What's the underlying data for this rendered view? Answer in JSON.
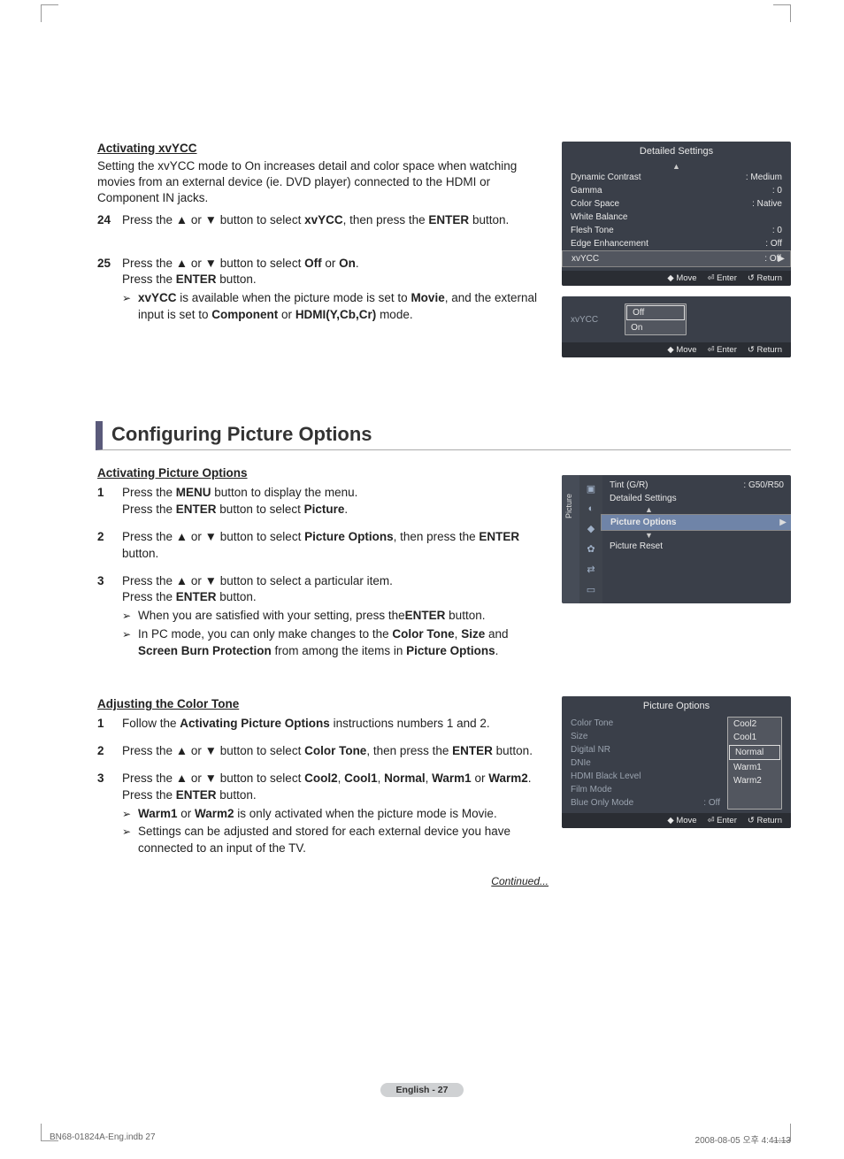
{
  "sec1": {
    "heading": "Activating xvYCC",
    "intro": "Setting the xvYCC mode to On increases detail and color space when watching movies from an external device (ie. DVD player) connected to the HDMI or Component IN jacks.",
    "steps": [
      {
        "num": "24",
        "t1": "Press the ▲ or ▼ button to select ",
        "b1": "xvYCC",
        "t2": ", then press the ",
        "b2": "ENTER",
        "t3": " button."
      },
      {
        "num": "25",
        "l1a": "Press the ▲ or ▼ button to select ",
        "l1b": "Off",
        "l1c": " or ",
        "l1d": "On",
        "l1e": ".",
        "l2a": "Press the ",
        "l2b": "ENTER",
        "l2c": " button.",
        "n1b": "xvYCC",
        "n1a": " is available when the picture mode is set to ",
        "n1c": "Movie",
        "n1d": ", and the external input is set to ",
        "n1e": "Component",
        "n1f": " or ",
        "n1g": "HDMI(Y,Cb,Cr)",
        "n1h": " mode."
      }
    ]
  },
  "osd1": {
    "title": "Detailed Settings",
    "rows": [
      {
        "k": "Dynamic Contrast",
        "v": ": Medium"
      },
      {
        "k": "Gamma",
        "v": ": 0"
      },
      {
        "k": "Color Space",
        "v": ": Native"
      },
      {
        "k": "White Balance",
        "v": ""
      },
      {
        "k": "Flesh Tone",
        "v": ": 0"
      },
      {
        "k": "Edge Enhancement",
        "v": ": Off"
      },
      {
        "k": "xvYCC",
        "v": ": Off"
      }
    ],
    "footer": [
      "◆ Move",
      "⏎ Enter",
      "↺ Return"
    ]
  },
  "osd2": {
    "label": "xvYCC",
    "options": [
      "Off",
      "On"
    ]
  },
  "sec2": {
    "title": "Configuring Picture Options",
    "sub1": "Activating Picture Options",
    "stepsA": [
      {
        "num": "1",
        "l1a": "Press the ",
        "l1b": "MENU",
        "l1c": " button to display the menu.",
        "l2a": "Press the ",
        "l2b": "ENTER",
        "l2c": " button to select ",
        "l2d": "Picture",
        "l2e": "."
      },
      {
        "num": "2",
        "l1a": "Press the ▲ or ▼ button to select ",
        "l1b": "Picture Options",
        "l1c": ", then press the ",
        "l1d": "ENTER",
        "l1e": " button."
      },
      {
        "num": "3",
        "l1": "Press the ▲ or ▼ button to select a particular item.",
        "l2a": "Press the ",
        "l2b": "ENTER",
        "l2c": " button.",
        "n1a": "When you are satisfied with your setting, press the",
        "n1b": "ENTER",
        "n1c": " button.",
        "n2a": "In PC mode, you can only make changes to the ",
        "n2b": "Color Tone",
        "n2c": ", ",
        "n2d": "Size",
        "n2e": " and ",
        "n2f": "Screen Burn Protection",
        "n2g": " from among the items in ",
        "n2h": "Picture Options",
        "n2i": "."
      }
    ],
    "sub2": "Adjusting the Color Tone",
    "stepsB": [
      {
        "num": "1",
        "l1a": "Follow the ",
        "l1b": "Activating Picture Options",
        "l1c": " instructions numbers 1 and 2."
      },
      {
        "num": "2",
        "l1a": "Press the ▲ or ▼ button to select ",
        "l1b": "Color Tone",
        "l1c": ", then press the ",
        "l1d": "ENTER",
        "l1e": " button."
      },
      {
        "num": "3",
        "l1a": "Press the ▲ or ▼ button to select ",
        "l1b": "Cool2",
        "l1c": ", ",
        "l1d": "Cool1",
        "l1e": ", ",
        "l1f": "Normal",
        "l1g": ", ",
        "l1h": "Warm1",
        "l1i": " or ",
        "l1j": "Warm2",
        "l1k": ".",
        "l2a": "Press the ",
        "l2b": "ENTER",
        "l2c": " button.",
        "n1a": "Warm1",
        "n1b": " or ",
        "n1c": "Warm2",
        "n1d": " is only activated when the picture mode is Movie.",
        "n2": "Settings can be adjusted and stored for each external device you have connected to an input of the TV."
      }
    ]
  },
  "osd3": {
    "side": "Picture",
    "rows": [
      {
        "k": "Tint (G/R)",
        "v": ": G50/R50"
      },
      {
        "k": "Detailed Settings"
      },
      {
        "k": "Picture Options"
      },
      {
        "k": "Picture Reset"
      }
    ]
  },
  "osd4": {
    "title": "Picture Options",
    "rows": [
      "Color Tone",
      "Size",
      "Digital NR",
      "DNIe",
      "HDMI Black Level",
      "Film Mode",
      "Blue Only Mode"
    ],
    "blueVal": ": Off",
    "opts": [
      "Cool2",
      "Cool1",
      "Normal",
      "Warm1",
      "Warm2"
    ]
  },
  "continued": "Continued...",
  "pageLabel": "English - 27",
  "printFoot": {
    "left": "BN68-01824A-Eng.indb   27",
    "right": "2008-08-05   오후 4:41:13"
  }
}
